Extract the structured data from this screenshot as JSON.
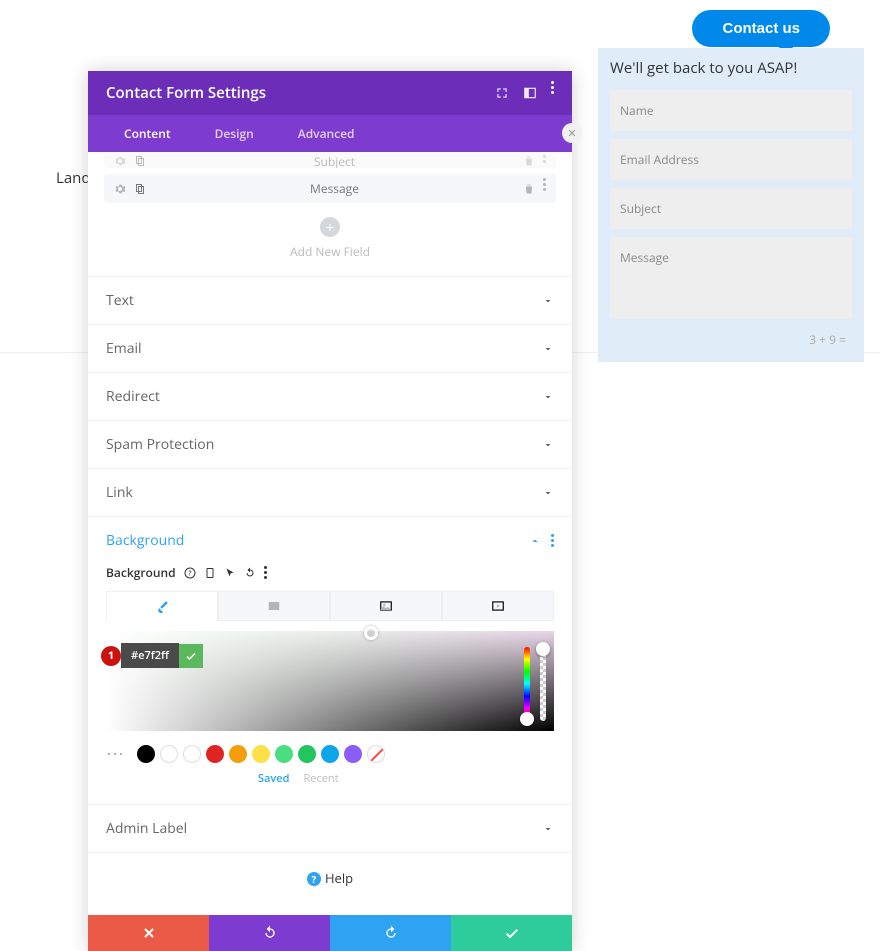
{
  "page": {
    "bg_text": "Landi"
  },
  "contact_button": "Contact us",
  "preview": {
    "heading": "We'll get back to you ASAP!",
    "fields": [
      "Name",
      "Email Address",
      "Subject",
      "Message"
    ],
    "math": "3 + 9 ="
  },
  "modal": {
    "title": "Contact Form Settings",
    "tabs": [
      "Content",
      "Design",
      "Advanced"
    ],
    "active_tab": 0,
    "field_rows": [
      "Subject",
      "Message"
    ],
    "add_field_label": "Add New Field",
    "sections": [
      "Text",
      "Email",
      "Redirect",
      "Spam Protection",
      "Link"
    ],
    "bg_section": "Background",
    "bg_label": "Background",
    "color_hex": "#e7f2ff",
    "callout_number": "1",
    "swatches": [
      "#000000",
      "outline",
      "outline",
      "#e02424",
      "#f59e0b",
      "#fde047",
      "#4ade80",
      "#22c55e",
      "#0ea5e9",
      "#8b5cf6",
      "none"
    ],
    "swatch_labels": {
      "saved": "Saved",
      "recent": "Recent"
    },
    "admin_label": "Admin Label",
    "help": "Help"
  }
}
